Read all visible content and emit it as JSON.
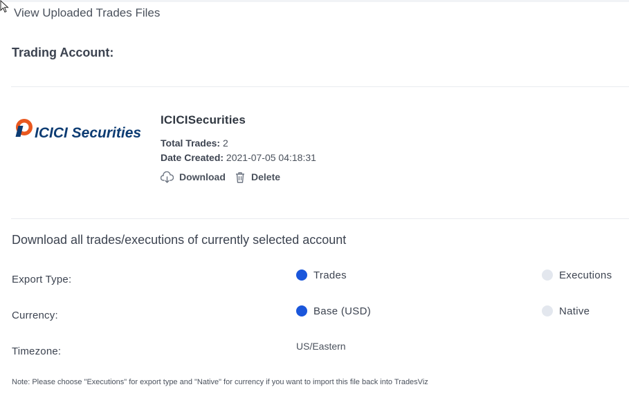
{
  "header": {
    "title": "View Uploaded Trades Files"
  },
  "account": {
    "label": "Trading Account:"
  },
  "file": {
    "logo_text": "ICICI Securities",
    "broker_name": "ICICISecurities",
    "total_trades_label": "Total Trades:",
    "total_trades_value": "2",
    "date_created_label": "Date Created:",
    "date_created_value": "2021-07-05 04:18:31",
    "download_label": "Download",
    "delete_label": "Delete"
  },
  "export": {
    "title": "Download all trades/executions of currently selected account",
    "export_type_label": "Export Type:",
    "export_type_options": [
      {
        "label": "Trades",
        "selected": true
      },
      {
        "label": "Executions",
        "selected": false
      }
    ],
    "currency_label": "Currency:",
    "currency_options": [
      {
        "label": "Base (USD)",
        "selected": true
      },
      {
        "label": "Native",
        "selected": false
      }
    ],
    "timezone_label": "Timezone:",
    "timezone_value": "US/Eastern",
    "note": "Note: Please choose \"Executions\" for export type and \"Native\" for currency if you want to import this file back into TradesViz"
  },
  "colors": {
    "accent": "#1a56db",
    "radio_off": "#e3e7ee",
    "logo_orange": "#e9581f",
    "logo_navy": "#0d3c73"
  }
}
